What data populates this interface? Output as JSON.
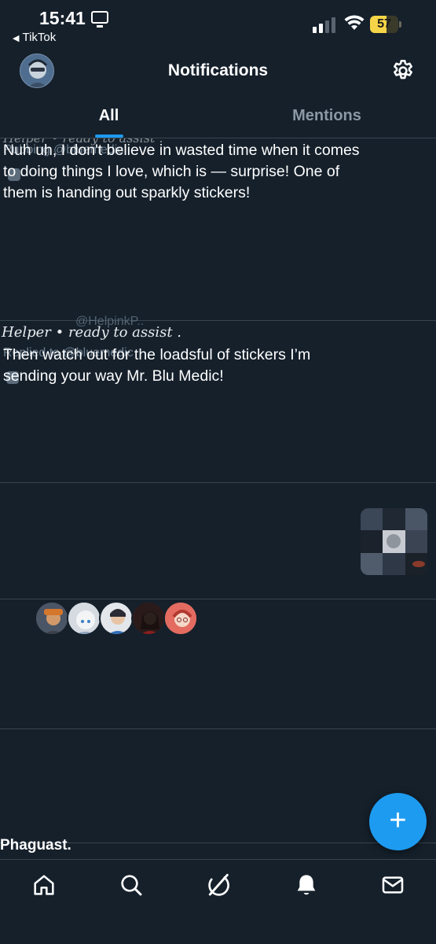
{
  "status_bar": {
    "time": "15:41",
    "back_app": "TikTok",
    "battery_percent": "57",
    "battery_level": 0.57
  },
  "header": {
    "title": "Notifications"
  },
  "tabs": {
    "all": "All",
    "mentions": "Mentions",
    "selected": "All"
  },
  "feed": {
    "item1": {
      "ghost_header": "Helper • ready to assist .",
      "ghost_liked": "Rubbing @bluemedic",
      "body": "Nuh uh, I don't believe in wasted time when it comes to doing things I love, which is — surprise! One of them is handing out sparkly stickers!"
    },
    "item2": {
      "ghost_handle": "@HelpinkP..",
      "ghost_header": "Helper • ready to assist .",
      "ghost_reply": "Replied to @bluemedic",
      "body": "Then watch out for the loadsful of stickers I’m sending your way Mr. Blu Medic!"
    },
    "partial_title": "Phaguast."
  },
  "fab": {
    "label": "+"
  },
  "nav": {
    "items": [
      "home-icon",
      "search-icon",
      "grok-icon",
      "bell-icon",
      "mail-icon"
    ],
    "selected": "bell-icon"
  },
  "colors": {
    "background": "#15202b",
    "accent": "#1d9bf0",
    "divider": "#38444d",
    "muted": "#8b98a5"
  }
}
